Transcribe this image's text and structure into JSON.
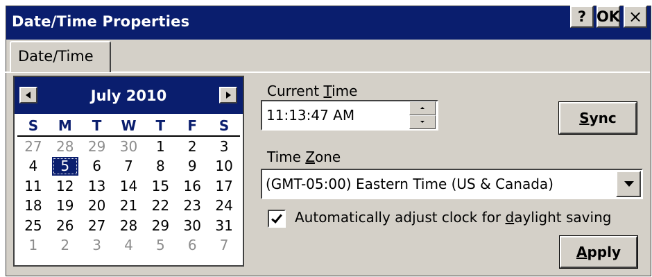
{
  "window": {
    "title": "Date/Time Properties",
    "help_label": "?",
    "ok_label": "OK",
    "close_label": "×"
  },
  "tabs": [
    {
      "label": "Date/Time"
    }
  ],
  "calendar": {
    "month_label": "July 2010",
    "weekday_headers": [
      "S",
      "M",
      "T",
      "W",
      "T",
      "F",
      "S"
    ],
    "days": [
      {
        "label": "27",
        "other": true
      },
      {
        "label": "28",
        "other": true
      },
      {
        "label": "29",
        "other": true
      },
      {
        "label": "30",
        "other": true
      },
      {
        "label": "1"
      },
      {
        "label": "2"
      },
      {
        "label": "3"
      },
      {
        "label": "4"
      },
      {
        "label": "5",
        "selected": true
      },
      {
        "label": "6"
      },
      {
        "label": "7"
      },
      {
        "label": "8"
      },
      {
        "label": "9"
      },
      {
        "label": "10"
      },
      {
        "label": "11"
      },
      {
        "label": "12"
      },
      {
        "label": "13"
      },
      {
        "label": "14"
      },
      {
        "label": "15"
      },
      {
        "label": "16"
      },
      {
        "label": "17"
      },
      {
        "label": "18"
      },
      {
        "label": "19"
      },
      {
        "label": "20"
      },
      {
        "label": "21"
      },
      {
        "label": "22"
      },
      {
        "label": "23"
      },
      {
        "label": "24"
      },
      {
        "label": "25"
      },
      {
        "label": "26"
      },
      {
        "label": "27"
      },
      {
        "label": "28"
      },
      {
        "label": "29"
      },
      {
        "label": "30"
      },
      {
        "label": "31"
      },
      {
        "label": "1",
        "other": true
      },
      {
        "label": "2",
        "other": true
      },
      {
        "label": "3",
        "other": true
      },
      {
        "label": "4",
        "other": true
      },
      {
        "label": "5",
        "other": true
      },
      {
        "label": "6",
        "other": true
      },
      {
        "label": "7",
        "other": true
      }
    ]
  },
  "current_time": {
    "label_before": "Current ",
    "label_accel": "T",
    "label_after": "ime",
    "value": "11:13:47 AM"
  },
  "time_zone": {
    "label_before": "Time ",
    "label_accel": "Z",
    "label_after": "one",
    "selected": "(GMT-05:00) Eastern Time (US & Canada)"
  },
  "daylight": {
    "checked": true,
    "label_before": "Automatically adjust clock for ",
    "label_accel": "d",
    "label_after": "aylight saving"
  },
  "sync_button": {
    "accel": "S",
    "rest": "ync"
  },
  "apply_button": {
    "accel": "A",
    "rest": "pply"
  },
  "colors": {
    "titlebar": "#0a1e6e",
    "face": "#d4d0c8",
    "other_month_day": "#8c8c8c"
  }
}
